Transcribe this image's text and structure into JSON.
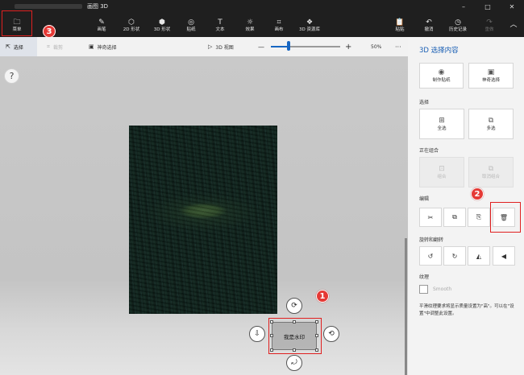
{
  "window": {
    "title": "画图 3D",
    "minimize": "–",
    "maximize": "□",
    "close": "✕"
  },
  "ribbon": {
    "menu": {
      "label": "菜单",
      "icon": "folder-icon",
      "glyph": "🗀"
    },
    "tools": [
      {
        "label": "画笔",
        "icon": "brush-icon",
        "glyph": "✎"
      },
      {
        "label": "2D 形状",
        "icon": "shapes-2d-icon",
        "glyph": "⬡"
      },
      {
        "label": "3D 形状",
        "icon": "cube-icon",
        "glyph": "⬢"
      },
      {
        "label": "贴纸",
        "icon": "sticker-icon",
        "glyph": "◎"
      },
      {
        "label": "文本",
        "icon": "text-icon",
        "glyph": "T"
      },
      {
        "label": "效果",
        "icon": "effects-icon",
        "glyph": "☼"
      },
      {
        "label": "画布",
        "icon": "canvas-icon",
        "glyph": "⌗"
      },
      {
        "label": "3D 资源库",
        "icon": "library-icon",
        "glyph": "❖"
      }
    ],
    "actions": [
      {
        "label": "粘贴",
        "icon": "paste-icon",
        "glyph": "📋"
      },
      {
        "label": "撤消",
        "icon": "undo-icon",
        "glyph": "↶"
      },
      {
        "label": "历史记录",
        "icon": "history-icon",
        "glyph": "◷"
      },
      {
        "label": "重做",
        "icon": "redo-icon",
        "glyph": "↷"
      }
    ],
    "collapse_glyph": "︿"
  },
  "subbar": {
    "select": "选择",
    "crop": "裁剪",
    "magic_select": "神奇选择",
    "view3d": "3D 视图",
    "zoom_out": "—",
    "zoom_in": "+",
    "zoom_percent": 25,
    "zoom_level": "50%",
    "more": "···"
  },
  "canvas": {
    "help": "?",
    "selection_text": "我是水印"
  },
  "annotations": {
    "badge1": "1",
    "badge2": "2",
    "badge3": "3"
  },
  "panel": {
    "title": "3D 选择内容",
    "make_sticker": "制作贴纸",
    "magic_select": "神奇选择",
    "section_select": "选择",
    "select_all": "全选",
    "multi_select": "多选",
    "section_group": "正在组合",
    "group": "组合",
    "ungroup": "取消组合",
    "section_edit": "编辑",
    "section_rotate": "旋转和翻转",
    "section_texture": "纹理",
    "smooth": "Smooth",
    "note": "平滑纹理要求将显示质量设置为\"高\"。可以在\"设置\"中调整此设置。"
  },
  "colors": {
    "accent": "#1766c2",
    "annotation_red": "#e02020",
    "titlebar": "#1f1f1f",
    "panel_bg": "#f3f3f3"
  }
}
